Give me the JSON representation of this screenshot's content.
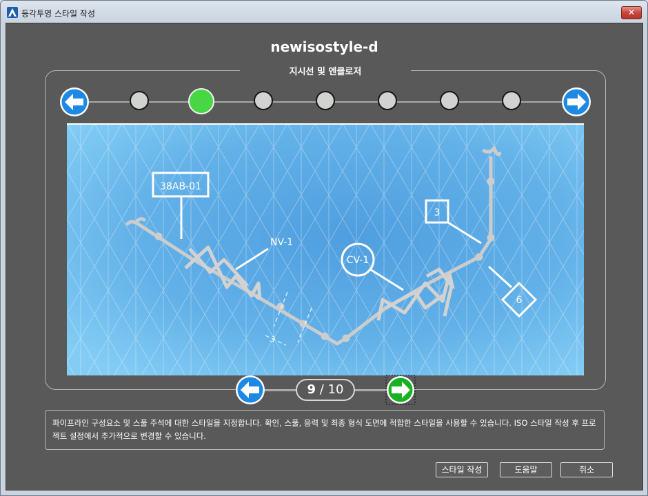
{
  "window": {
    "title": "등각투영 스타일 작성",
    "close_glyph": "✕"
  },
  "style_name": "newisostyle-d",
  "section_title": "지시선 및 엔클로저",
  "steps": {
    "count": 8,
    "active_index": 2
  },
  "preview": {
    "tags": {
      "line_number": "38AB-01",
      "valve_tag": "NV-1",
      "valve_enclosure": "CV-1",
      "box": "3",
      "diamond": "6",
      "dimension": "3"
    },
    "colors": {
      "background": "#66b5e8",
      "pipe": "#c8c8c8",
      "annotation": "#ffffff"
    }
  },
  "pager": {
    "current": "9",
    "total": "/ 10"
  },
  "description": "파이프라인 구성요소 및 스풀 주석에 대한 스타일을 지정합니다. 확인, 스풀, 응력 및 최종 형식 도면에 적합한 스타일을 사용할 수 있습니다. ISO 스타일 작성 후 프로젝트 설정에서 추가적으로 변경할 수 있습니다.",
  "buttons": {
    "create": "스타일 작성",
    "help": "도움말",
    "cancel": "취소"
  },
  "colors": {
    "accent_blue": "#1e88e5",
    "active_step": "#49d645",
    "next_green": "#19b021",
    "panel_bg": "#595959"
  }
}
